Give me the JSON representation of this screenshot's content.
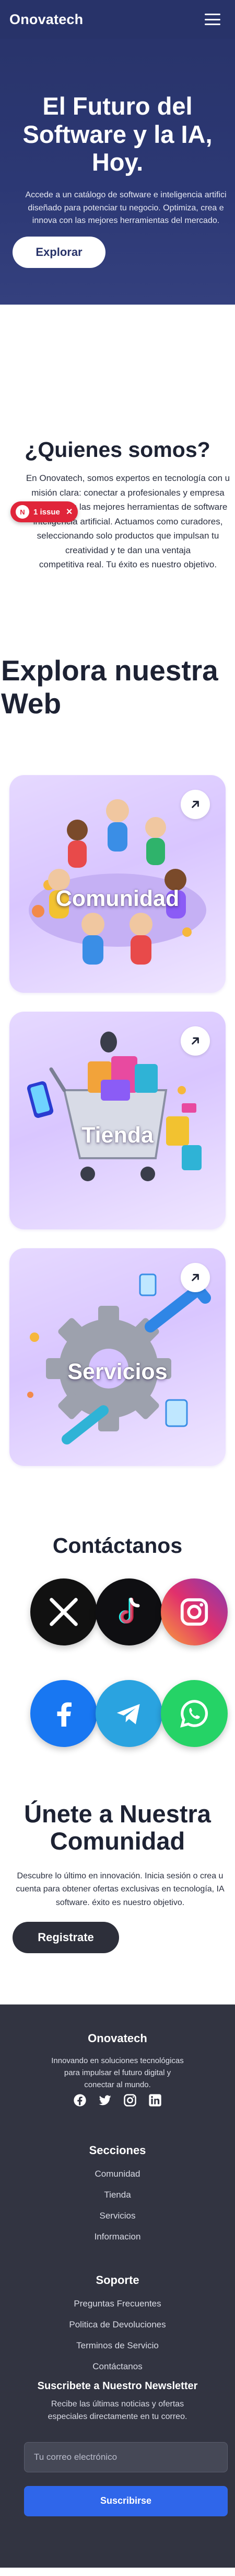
{
  "header": {
    "logo": "Onovatech"
  },
  "hero": {
    "title": "El Futuro del Software y la IA, Hoy.",
    "subtitle_lines": [
      "Accede a un catálogo de software e inteligencia artifici",
      "diseñado para potenciar tu negocio. Optimiza, crea e",
      "innova con las mejores herramientas del mercado."
    ],
    "button": "Explorar"
  },
  "about": {
    "title": "¿Quienes somos?",
    "text_lines": [
      "En Onovatech, somos expertos en tecnología con u",
      "misión clara: conectar a profesionales y empresa",
      "como tú con las mejores herramientas de software",
      "inteligencia artificial. Actuamos como curadores,",
      "seleccionando solo productos que impulsan tu",
      "creatividad y te dan una ventaja",
      "competitiva real. Tu éxito es nuestro objetivo."
    ]
  },
  "issue_badge": {
    "logo": "N",
    "label": "1 issue",
    "close": "×"
  },
  "explore": {
    "title": "Explora nuestra Web",
    "cards": [
      {
        "label": "Comunidad",
        "arrow": "↗"
      },
      {
        "label": "Tienda",
        "arrow": "↗"
      },
      {
        "label": "Servicios",
        "arrow": "↗"
      }
    ]
  },
  "contact": {
    "title": "Contáctanos",
    "networks": [
      "x-logo",
      "tiktok-logo",
      "instagram-logo",
      "facebook-logo",
      "telegram-logo",
      "whatsapp-logo"
    ]
  },
  "join": {
    "title": "Únete a Nuestra Comunidad",
    "text_lines": [
      "Descubre lo último en innovación. Inicia sesión o crea u",
      "cuenta para obtener ofertas exclusivas en tecnología, IA",
      "software. éxito es nuestro objetivo."
    ],
    "button": "Registrate"
  },
  "footer": {
    "brand": "Onovatech",
    "description": "Innovando en soluciones tecnológicas para impulsar el futuro digital y conectar al mundo.",
    "sections_title": "Secciones",
    "sections": [
      "Comunidad",
      "Tienda",
      "Servicios",
      "Informacion"
    ],
    "support_title": "Soporte",
    "support": [
      "Preguntas Frecuentes",
      "Politica de Devoluciones",
      "Terminos de Servicio",
      "Contáctanos"
    ],
    "newsletter": {
      "title": "Suscribete a Nuestro Newsletter",
      "text": "Recibe las últimas noticias y ofertas especiales directamente en tu correo.",
      "placeholder": "Tu correo electrónico",
      "button": "Suscribirse"
    }
  },
  "colors": {
    "hero_bg": "#283369",
    "card_bg": "#ddcbff",
    "footer_bg": "#323441",
    "subscribe_button": "#2f66ea",
    "issue_badge": "#e0253a"
  }
}
